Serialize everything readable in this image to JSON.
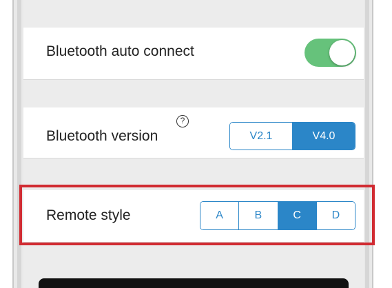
{
  "settings": {
    "bluetooth_auto_connect": {
      "label": "Bluetooth auto connect",
      "enabled": true
    },
    "bluetooth_version": {
      "label": "Bluetooth version",
      "help_icon": "?",
      "options": [
        "V2.1",
        "V4.0"
      ],
      "selected": "V4.0"
    },
    "remote_style": {
      "label": "Remote style",
      "options": [
        "A",
        "B",
        "C",
        "D"
      ],
      "selected": "C"
    }
  },
  "colors": {
    "accent": "#2b86c8",
    "toggle_on": "#66c27b",
    "highlight": "#d12b32",
    "background": "#ececec"
  }
}
